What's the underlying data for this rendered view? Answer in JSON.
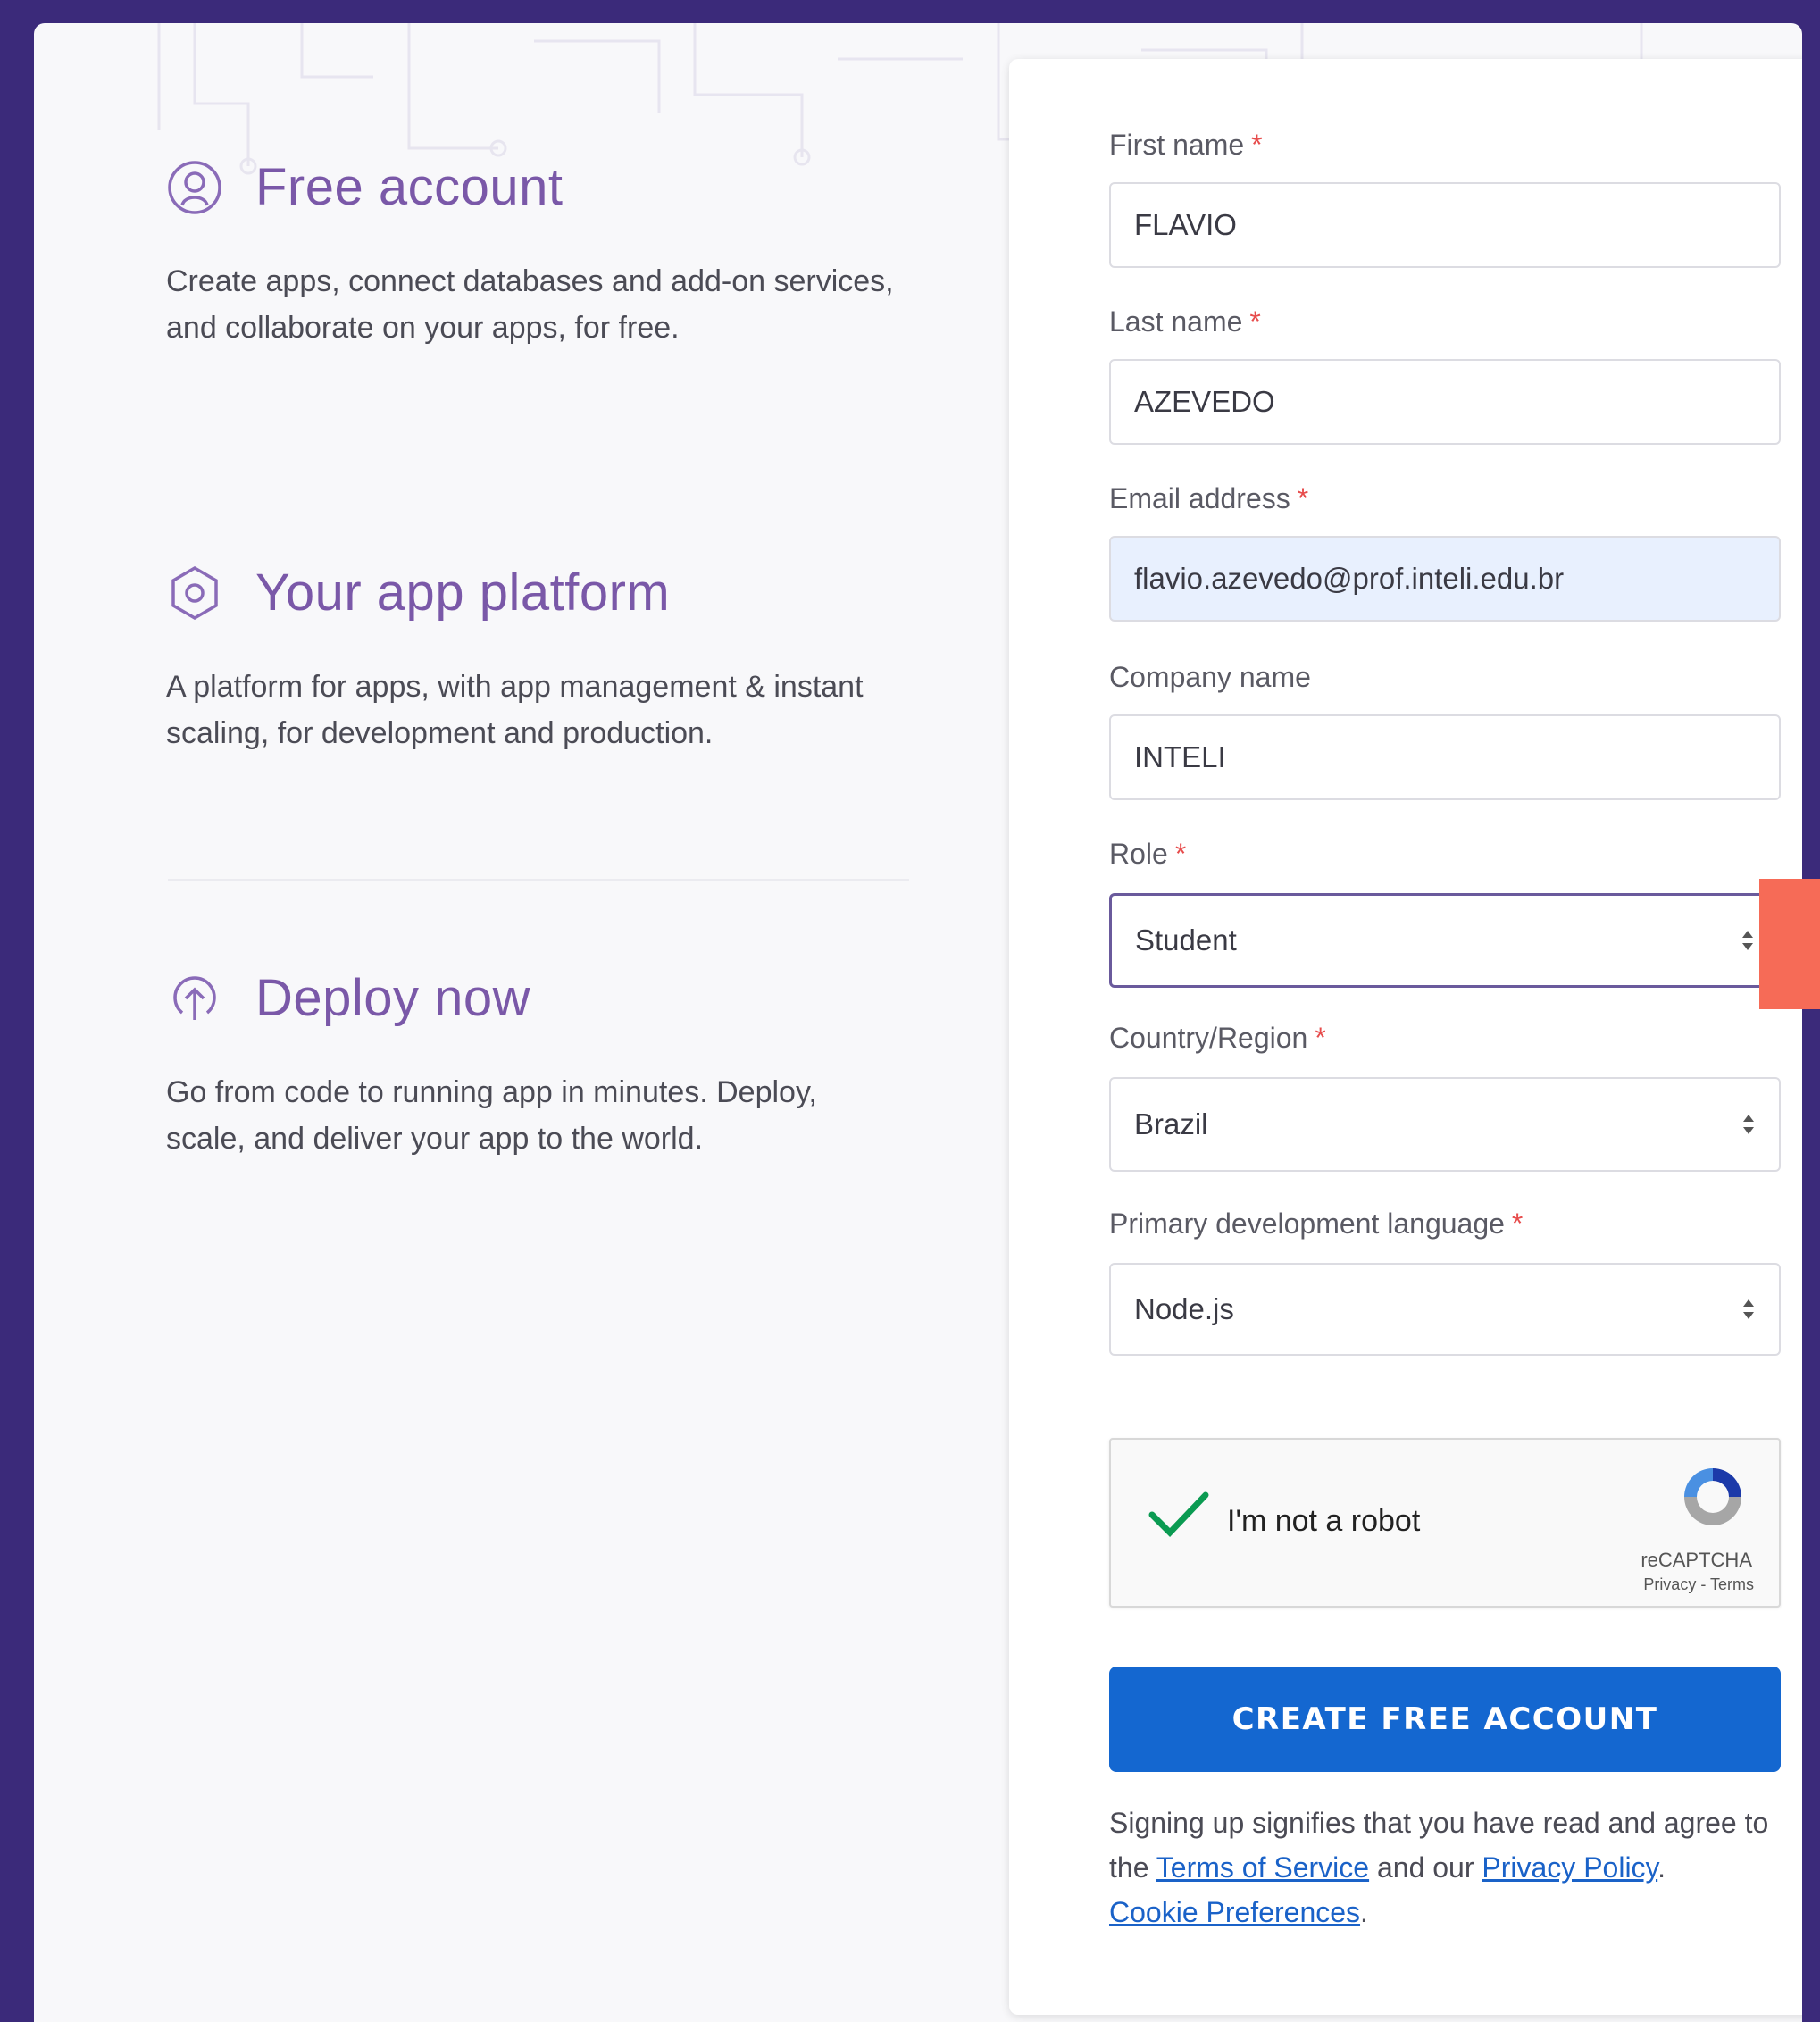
{
  "features": [
    {
      "icon": "user-circle-icon",
      "title": "Free account",
      "description": "Create apps, connect databases and add-on services, and collaborate on your apps, for free."
    },
    {
      "icon": "hexagon-icon",
      "title": "Your app platform",
      "description": "A platform for apps, with app management & instant scaling, for development and production."
    },
    {
      "icon": "upload-circle-icon",
      "title": "Deploy now",
      "description": "Go from code to running app in minutes. Deploy, scale, and deliver your app to the world."
    }
  ],
  "form": {
    "first_name": {
      "label": "First name",
      "required_mark": "*",
      "value": "FLAVIO"
    },
    "last_name": {
      "label": "Last name",
      "required_mark": "*",
      "value": "AZEVEDO"
    },
    "email": {
      "label": "Email address",
      "required_mark": "*",
      "value": "flavio.azevedo@prof.inteli.edu.br"
    },
    "company": {
      "label": "Company name",
      "value": "INTELI"
    },
    "role": {
      "label": "Role",
      "required_mark": "*",
      "value": "Student"
    },
    "country": {
      "label": "Country/Region",
      "required_mark": "*",
      "value": "Brazil"
    },
    "language": {
      "label": "Primary development language",
      "required_mark": "*",
      "value": "Node.js"
    },
    "captcha": {
      "label": "I'm not a robot",
      "brand": "reCAPTCHA",
      "privacy": "Privacy",
      "separator": " - ",
      "terms": "Terms"
    },
    "submit_label": "CREATE FREE ACCOUNT",
    "legal": {
      "text_1": "Signing up signifies that you have read and agree to the ",
      "terms_link": "Terms of Service",
      "text_2": " and our ",
      "privacy_link": "Privacy Policy",
      "text_3": ".",
      "cookie_link": "Cookie Preferences",
      "text_4": "."
    }
  },
  "colors": {
    "background": "#3b2a7a",
    "accent_purple": "#7a58a8",
    "button_blue": "#1467d0",
    "side_tab": "#f66b57",
    "required": "#e74c4c"
  }
}
